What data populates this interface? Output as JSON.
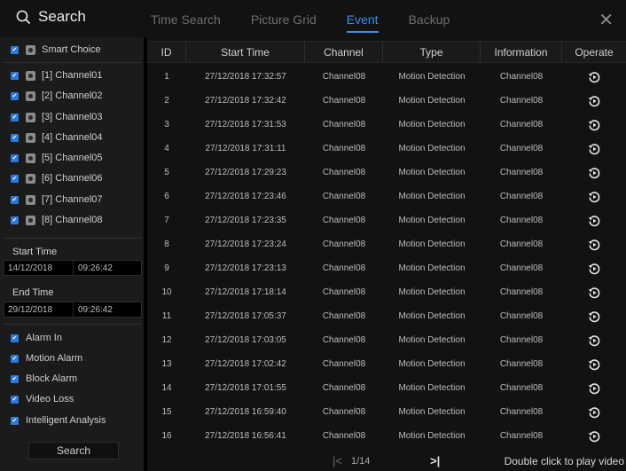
{
  "header": {
    "title": "Search",
    "tabs": [
      {
        "label": "Time Search",
        "active": false
      },
      {
        "label": "Picture Grid",
        "active": false
      },
      {
        "label": "Event",
        "active": true
      },
      {
        "label": "Backup",
        "active": false
      }
    ],
    "close_icon": "close-icon"
  },
  "sidebar": {
    "smart_choice": "Smart Choice",
    "channels": [
      "[1] Channel01",
      "[2] Channel02",
      "[3] Channel03",
      "[4] Channel04",
      "[5] Channel05",
      "[6] Channel06",
      "[7] Channel07",
      "[8] Channel08"
    ],
    "start_time_label": "Start Time",
    "start_date": "14/12/2018",
    "start_time": "09:26:42",
    "end_time_label": "End Time",
    "end_date": "29/12/2018",
    "end_time": "09:26:42",
    "filters": [
      "Alarm In",
      "Motion Alarm",
      "Block Alarm",
      "Video Loss",
      "Intelligent Analysis"
    ],
    "search_button": "Search"
  },
  "table": {
    "columns": [
      "ID",
      "Start Time",
      "Channel",
      "Type",
      "Information",
      "Operate"
    ],
    "rows": [
      {
        "id": "1",
        "start": "27/12/2018 17:32:57",
        "channel": "Channel08",
        "type": "Motion Detection",
        "info": "Channel08"
      },
      {
        "id": "2",
        "start": "27/12/2018 17:32:42",
        "channel": "Channel08",
        "type": "Motion Detection",
        "info": "Channel08"
      },
      {
        "id": "3",
        "start": "27/12/2018 17:31:53",
        "channel": "Channel08",
        "type": "Motion Detection",
        "info": "Channel08"
      },
      {
        "id": "4",
        "start": "27/12/2018 17:31:11",
        "channel": "Channel08",
        "type": "Motion Detection",
        "info": "Channel08"
      },
      {
        "id": "5",
        "start": "27/12/2018 17:29:23",
        "channel": "Channel08",
        "type": "Motion Detection",
        "info": "Channel08"
      },
      {
        "id": "6",
        "start": "27/12/2018 17:23:46",
        "channel": "Channel08",
        "type": "Motion Detection",
        "info": "Channel08"
      },
      {
        "id": "7",
        "start": "27/12/2018 17:23:35",
        "channel": "Channel08",
        "type": "Motion Detection",
        "info": "Channel08"
      },
      {
        "id": "8",
        "start": "27/12/2018 17:23:24",
        "channel": "Channel08",
        "type": "Motion Detection",
        "info": "Channel08"
      },
      {
        "id": "9",
        "start": "27/12/2018 17:23:13",
        "channel": "Channel08",
        "type": "Motion Detection",
        "info": "Channel08"
      },
      {
        "id": "10",
        "start": "27/12/2018 17:18:14",
        "channel": "Channel08",
        "type": "Motion Detection",
        "info": "Channel08"
      },
      {
        "id": "11",
        "start": "27/12/2018 17:05:37",
        "channel": "Channel08",
        "type": "Motion Detection",
        "info": "Channel08"
      },
      {
        "id": "12",
        "start": "27/12/2018 17:03:05",
        "channel": "Channel08",
        "type": "Motion Detection",
        "info": "Channel08"
      },
      {
        "id": "13",
        "start": "27/12/2018 17:02:42",
        "channel": "Channel08",
        "type": "Motion Detection",
        "info": "Channel08"
      },
      {
        "id": "14",
        "start": "27/12/2018 17:01:55",
        "channel": "Channel08",
        "type": "Motion Detection",
        "info": "Channel08"
      },
      {
        "id": "15",
        "start": "27/12/2018 16:59:40",
        "channel": "Channel08",
        "type": "Motion Detection",
        "info": "Channel08"
      },
      {
        "id": "16",
        "start": "27/12/2018 16:56:41",
        "channel": "Channel08",
        "type": "Motion Detection",
        "info": "Channel08"
      }
    ]
  },
  "footer": {
    "page": "1/14",
    "hint": "Double click to play video"
  },
  "colors": {
    "accent": "#3f8ee8",
    "checkbox": "#2d79d8",
    "background": "#000000",
    "panel": "#1b1b1b"
  }
}
